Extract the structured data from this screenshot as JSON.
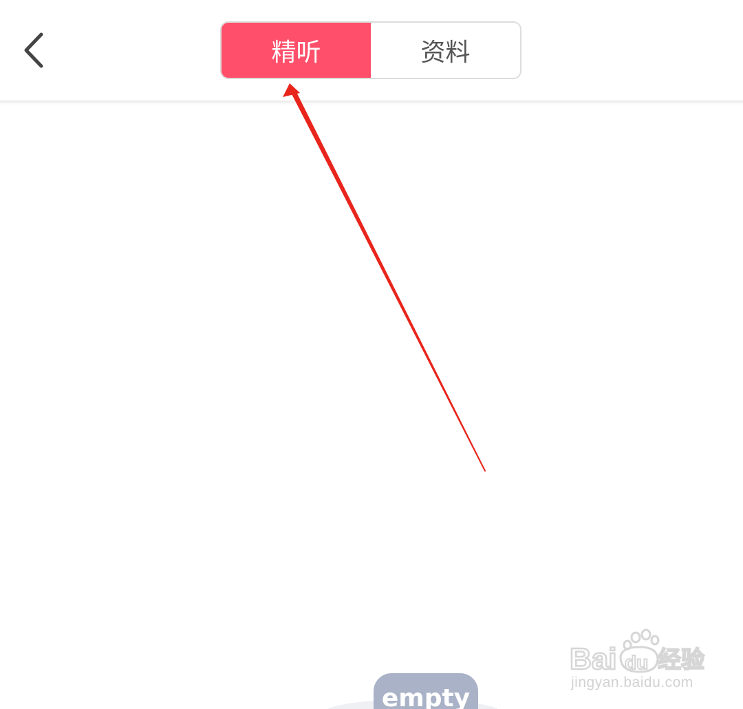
{
  "header": {
    "back_icon": "chevron-left-icon",
    "tabs": [
      {
        "label": "精听",
        "active": true
      },
      {
        "label": "资料",
        "active": false
      }
    ]
  },
  "empty_state": {
    "label": "empty"
  },
  "watermark": {
    "brand": "Baidu经验",
    "url": "jingyan.baidu.com"
  },
  "colors": {
    "accent": "#ff4f6a",
    "annotation_arrow": "#e8251c",
    "empty_badge": "#a9b2c6"
  }
}
